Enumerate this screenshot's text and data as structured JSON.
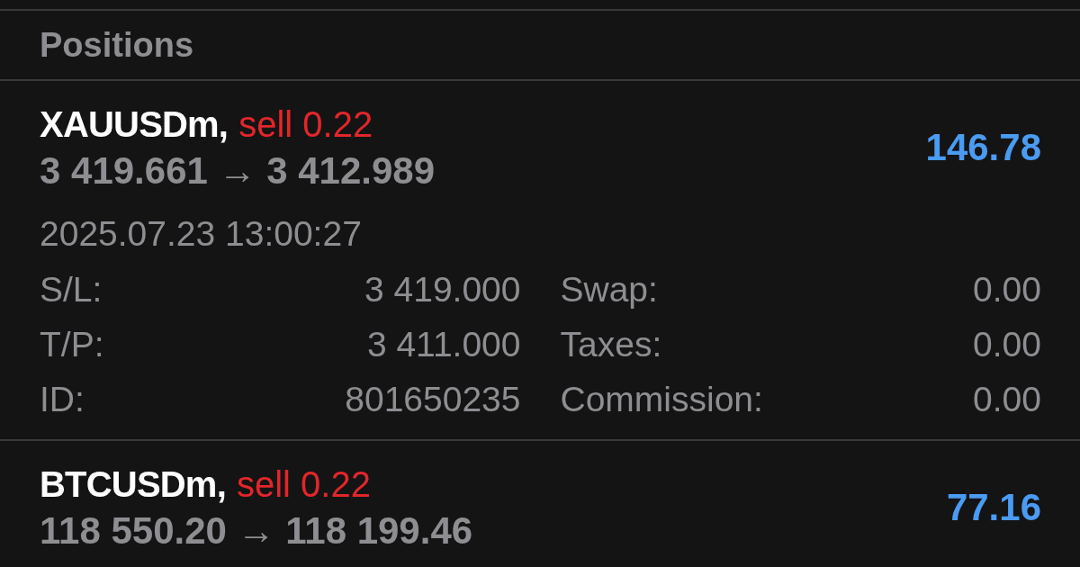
{
  "section_title": "Positions",
  "positions": [
    {
      "symbol": "XAUUSDm,",
      "kind": "sell",
      "order": "sell 0.22",
      "prices": "3 419.661 → 3 412.989",
      "profit": "146.78",
      "open_time": "2025.07.23 13:00:27",
      "details": [
        {
          "label": "S/L:",
          "value": "3 419.000"
        },
        {
          "label": "Swap:",
          "value": "0.00"
        },
        {
          "label": "T/P:",
          "value": "3 411.000"
        },
        {
          "label": "Taxes:",
          "value": "0.00"
        },
        {
          "label": "ID:",
          "value": "801650235"
        },
        {
          "label": "Commission:",
          "value": "0.00"
        }
      ]
    },
    {
      "symbol": "BTCUSDm,",
      "kind": "sell",
      "order": "sell 0.22",
      "prices": "118 550.20 → 118 199.46",
      "profit": "77.16"
    }
  ]
}
